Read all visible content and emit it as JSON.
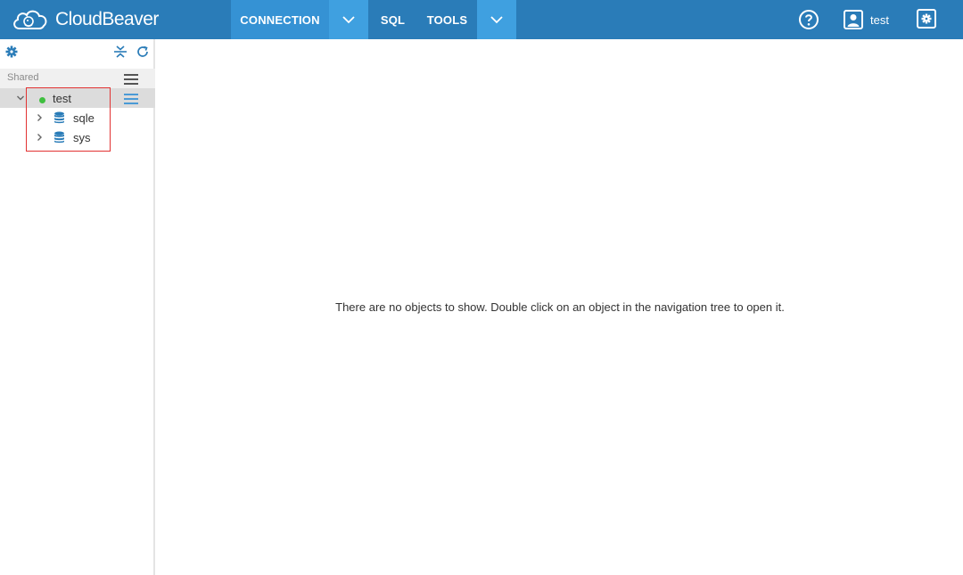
{
  "app": {
    "logo_text": "CloudBeaver",
    "logo_icon": "beaver-cloud-icon"
  },
  "topnav": {
    "items": [
      {
        "label": "CONNECTION"
      },
      {
        "label": ""
      },
      {
        "label": "SQL"
      },
      {
        "label": "TOOLS"
      },
      {
        "label": ""
      }
    ],
    "help_icon": "help-circle-icon",
    "user_icon": "user-icon",
    "user_name": "test",
    "settings_icon": "settings-gear-icon"
  },
  "sidebar": {
    "toolbar": {
      "settings_icon": "gear-icon",
      "collapse_icon": "collapse-all-icon",
      "refresh_icon": "refresh-icon"
    },
    "folder_label": "Shared",
    "connection": {
      "name": "test",
      "status": "connected",
      "status_color": "#3fbf3f"
    },
    "databases": [
      {
        "name": "sqle"
      },
      {
        "name": "sys"
      }
    ]
  },
  "main": {
    "empty_message": "There are no objects to show. Double click on an object in the navigation tree to open it."
  },
  "colors": {
    "topbar": "#2a7cb8",
    "active_tab": "#3592d4",
    "dropdown_tab": "#3fa0e0",
    "db_icon": "#2a7cb8",
    "highlight": "#e23232"
  }
}
